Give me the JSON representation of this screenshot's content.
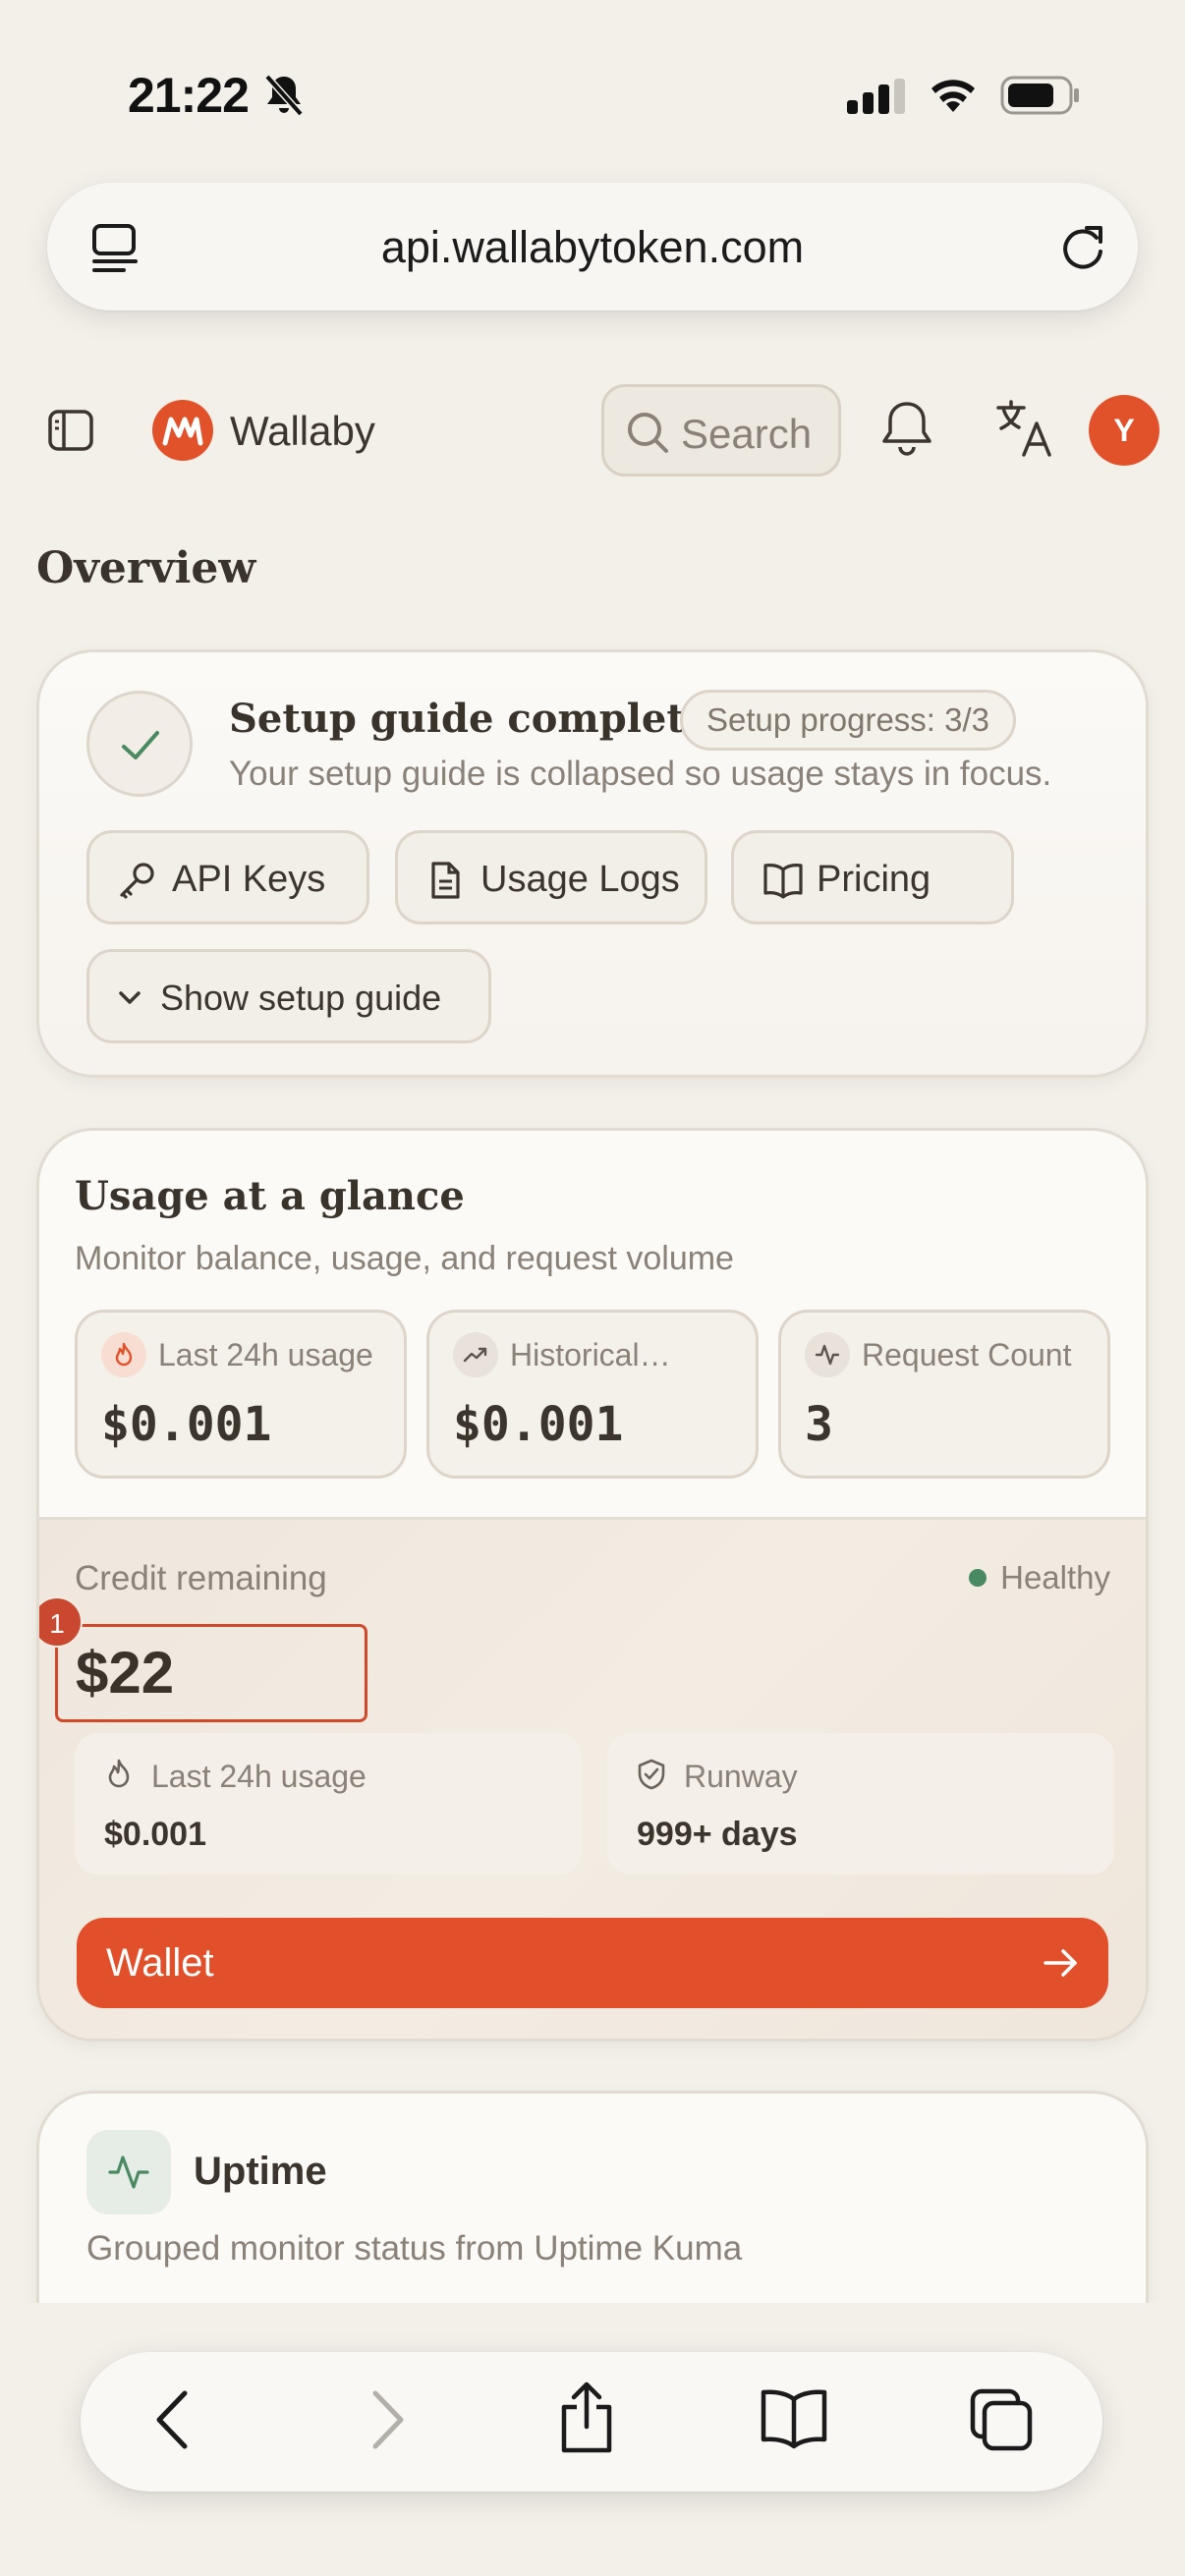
{
  "status_bar": {
    "time": "21:22"
  },
  "browser": {
    "url": "api.wallabytoken.com"
  },
  "header": {
    "brand": "Wallaby",
    "search_placeholder": "Search",
    "avatar_initial": "Y"
  },
  "page": {
    "title": "Overview"
  },
  "setup": {
    "title": "Setup guide complete",
    "progress": "Setup progress: 3/3",
    "subtitle": "Your setup guide is collapsed so usage stays in focus.",
    "buttons": {
      "api_keys": "API Keys",
      "usage_logs": "Usage Logs",
      "pricing": "Pricing",
      "show_guide": "Show setup guide"
    }
  },
  "usage": {
    "title": "Usage at a glance",
    "subtitle": "Monitor balance, usage, and request volume",
    "stats": [
      {
        "label": "Last 24h usage",
        "value": "$0.001"
      },
      {
        "label": "Historical…",
        "value": "$0.001"
      },
      {
        "label": "Request Count",
        "value": "3"
      }
    ],
    "credit": {
      "label": "Credit remaining",
      "status": "Healthy",
      "value": "$22",
      "marker": "1",
      "last24_label": "Last 24h usage",
      "last24_value": "$0.001",
      "runway_label": "Runway",
      "runway_value": "999+ days",
      "wallet_label": "Wallet"
    }
  },
  "uptime": {
    "title": "Uptime",
    "subtitle": "Grouped monitor status from Uptime Kuma"
  },
  "colors": {
    "accent": "#e1502a",
    "healthy": "#4a8a62",
    "background": "#f3efe9"
  }
}
